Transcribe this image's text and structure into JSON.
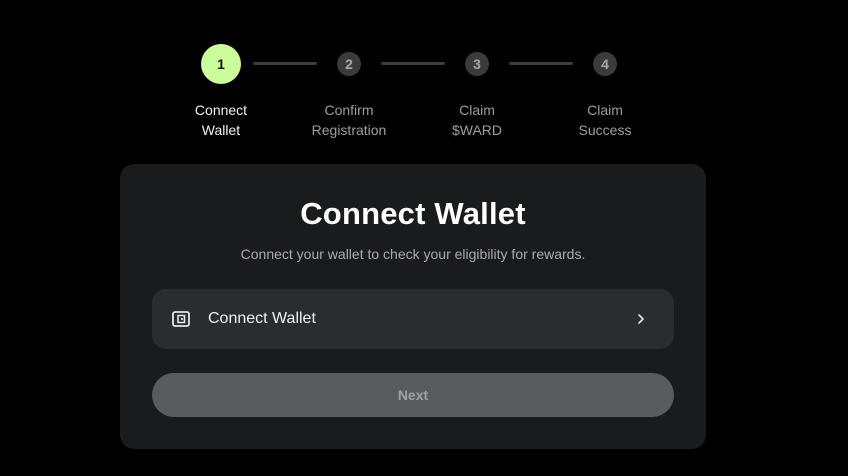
{
  "stepper": {
    "steps": [
      {
        "number": "1",
        "label_line1": "Connect",
        "label_line2": "Wallet",
        "state": "active"
      },
      {
        "number": "2",
        "label_line1": "Confirm",
        "label_line2": "Registration",
        "state": "inactive"
      },
      {
        "number": "3",
        "label_line1": "Claim",
        "label_line2": "$WARD",
        "state": "inactive"
      },
      {
        "number": "4",
        "label_line1": "Claim",
        "label_line2": "Success",
        "state": "inactive"
      }
    ]
  },
  "card": {
    "title": "Connect Wallet",
    "subtitle": "Connect your wallet to check your eligibility for rewards.",
    "wallet_option": {
      "label": "Connect Wallet",
      "icon": "wallet-icon",
      "trailing_icon": "chevron-right-icon"
    },
    "next_button": {
      "label": "Next",
      "state": "disabled"
    }
  },
  "colors": {
    "background": "#000000",
    "card_background": "#1a1b1d",
    "active_step": "#cdfc9a",
    "option_background": "#2b2c2f",
    "next_button_background": "#5a5b5f"
  }
}
